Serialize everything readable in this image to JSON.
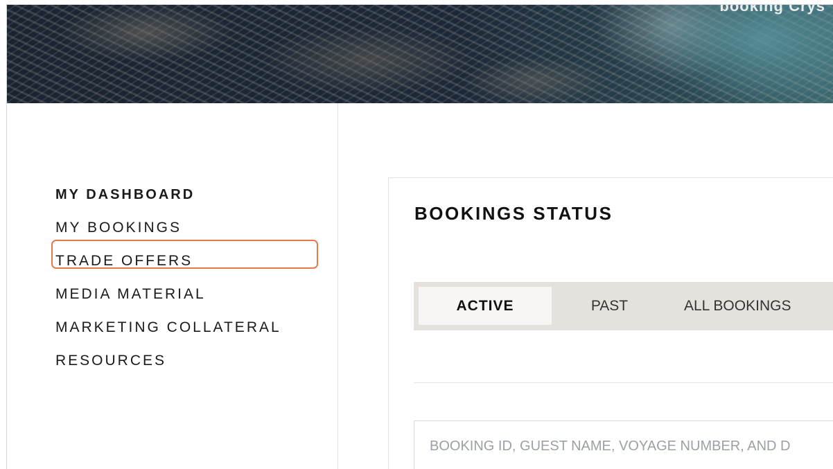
{
  "hero": {
    "caption": "booking Crys"
  },
  "sidebar": {
    "items": [
      {
        "label": "MY DASHBOARD"
      },
      {
        "label": "MY BOOKINGS"
      },
      {
        "label": "TRADE OFFERS"
      },
      {
        "label": "MEDIA MATERIAL"
      },
      {
        "label": "MARKETING COLLATERAL"
      },
      {
        "label": "RESOURCES"
      }
    ],
    "active_item": "MY DASHBOARD",
    "highlighted_item": "TRADE OFFERS"
  },
  "main": {
    "title": "BOOKINGS STATUS",
    "tabs": [
      {
        "label": "ACTIVE",
        "selected": true
      },
      {
        "label": "PAST",
        "selected": false
      },
      {
        "label": "ALL BOOKINGS",
        "selected": false
      }
    ],
    "search": {
      "placeholder": "BOOKING ID, GUEST NAME, VOYAGE NUMBER, AND D"
    }
  },
  "colors": {
    "highlight": "#e8784a",
    "tab_bar": "#e5e2de",
    "active_tab": "#f7f6f4"
  }
}
